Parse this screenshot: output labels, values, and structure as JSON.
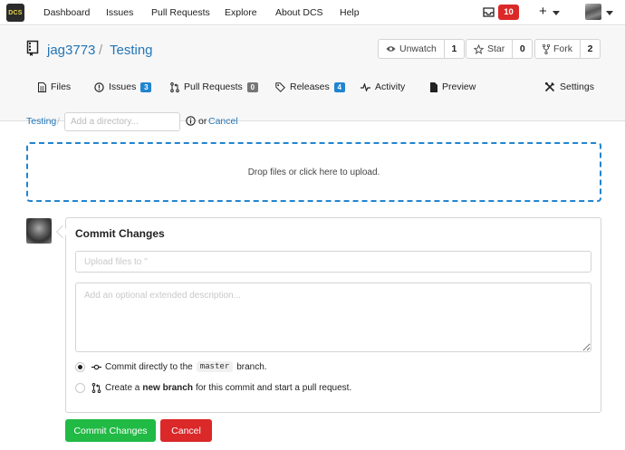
{
  "nav": {
    "logo_text": "DCS",
    "items": [
      "Dashboard",
      "Issues",
      "Pull Requests",
      "Explore",
      "About DCS",
      "Help"
    ],
    "notification_count": "10",
    "plus": "+"
  },
  "repo": {
    "owner": "jag3773",
    "separator": "/",
    "name": "Testing",
    "watch": {
      "label": "Unwatch",
      "count": "1"
    },
    "star": {
      "label": "Star",
      "count": "0"
    },
    "fork": {
      "label": "Fork",
      "count": "2"
    }
  },
  "tabs": {
    "files": {
      "label": "Files"
    },
    "issues": {
      "label": "Issues",
      "count": "3"
    },
    "pulls": {
      "label": "Pull Requests",
      "count": "0"
    },
    "releases": {
      "label": "Releases",
      "count": "4"
    },
    "activity": {
      "label": "Activity"
    },
    "preview": {
      "label": "Preview"
    },
    "settings": {
      "label": "Settings"
    }
  },
  "breadcrumb": {
    "repo": "Testing",
    "separator": "/",
    "dir_placeholder": "Add a directory...",
    "or": "or",
    "cancel": "Cancel"
  },
  "dropzone": {
    "text": "Drop files or click here to upload."
  },
  "commit": {
    "title": "Commit Changes",
    "summary_placeholder": "Upload files to ''",
    "desc_placeholder": "Add an optional extended description...",
    "option_direct": {
      "before": "Commit directly to the",
      "branch": "master",
      "after": "branch."
    },
    "option_new": {
      "before": "Create a",
      "bold": "new branch",
      "after": "for this commit and start a pull request."
    },
    "selected": "direct",
    "submit_label": "Commit Changes",
    "cancel_label": "Cancel"
  },
  "colors": {
    "link": "#2376b7",
    "primary_blue": "#2185d0",
    "green": "#21ba45",
    "red": "#db2828"
  }
}
